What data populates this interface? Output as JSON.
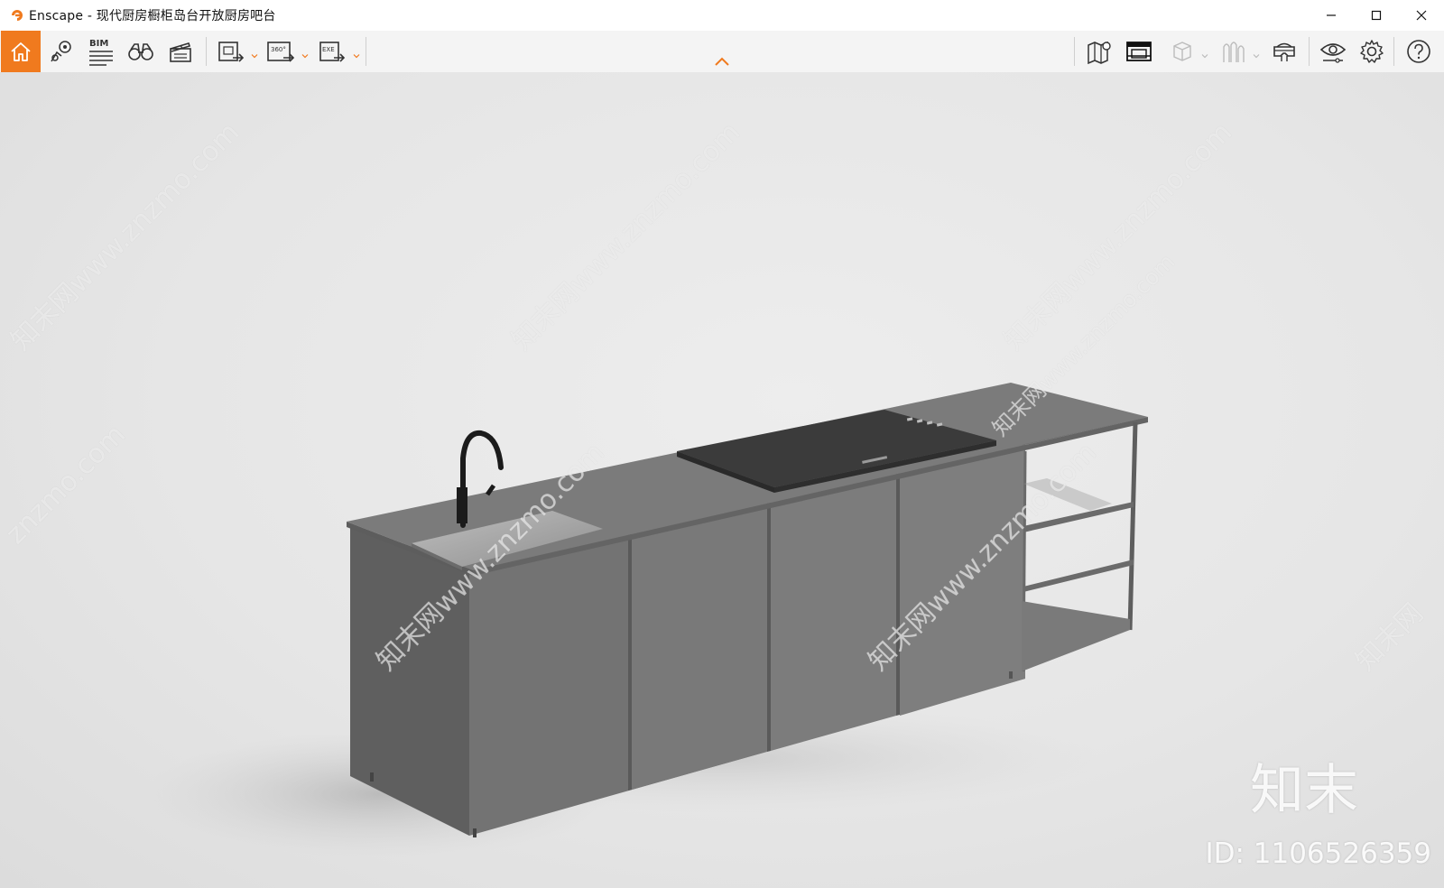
{
  "window": {
    "title": "Enscape - 现代厨房橱柜岛台开放厨房吧台",
    "controls": [
      "minimize-icon",
      "maximize-icon",
      "close-icon"
    ]
  },
  "colors": {
    "accent": "#f07a1e",
    "toolbar_bg": "#f4f4f4",
    "icon": "#333333"
  },
  "toolbar": {
    "left": [
      {
        "name": "home-icon",
        "active": true
      },
      {
        "name": "views-pin-icon"
      },
      {
        "name": "bim-icon",
        "label": "BIM"
      },
      {
        "name": "binoculars-icon"
      },
      {
        "name": "clapperboard-icon"
      },
      {
        "name": "screenshot-export-icon",
        "dropdown": true
      },
      {
        "name": "panorama-export-icon",
        "label": "360°",
        "dropdown": true
      },
      {
        "name": "exe-export-icon",
        "label": "EXE",
        "dropdown": true
      }
    ],
    "center": {
      "name": "collapse-chevron-icon"
    },
    "right": [
      {
        "name": "map-icon"
      },
      {
        "name": "minimap-icon"
      },
      {
        "name": "cube-icon",
        "dropdown": true,
        "disabled": true
      },
      {
        "name": "asset-library-icon",
        "dropdown": true,
        "disabled": true
      },
      {
        "name": "vr-headset-icon"
      },
      {
        "name": "visual-settings-eye-icon"
      },
      {
        "name": "settings-gear-icon"
      },
      {
        "name": "help-icon"
      }
    ]
  },
  "viewport": {
    "scene": "kitchen-island-render",
    "watermarks": [
      "知末网www.znzmo.com",
      "知末网www.znzmo.com",
      "知末网www.znzmo.com",
      "znzmo.com",
      "知末网www.znzmo.com",
      "知末网www.znzmo.com",
      "知末网www.znzmo.com",
      "知末网"
    ],
    "brand": "知末",
    "id_text": "ID: 1106526359"
  }
}
